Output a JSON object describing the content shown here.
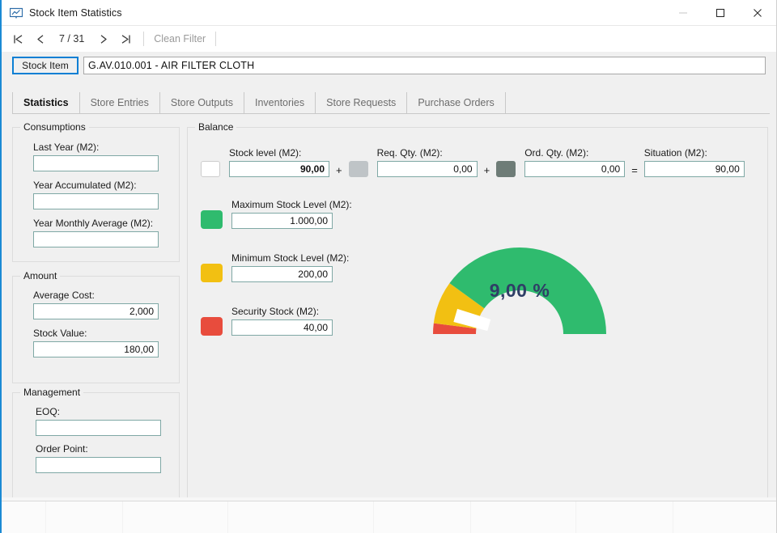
{
  "window": {
    "title": "Stock Item Statistics",
    "icon": "chart-window-icon",
    "minimize_label": "—",
    "maximize_label": "□",
    "close_label": "✕"
  },
  "toolbar": {
    "first_icon": "first-record-icon",
    "prev_icon": "previous-record-icon",
    "counter": "7 / 31",
    "next_icon": "next-record-icon",
    "last_icon": "last-record-icon",
    "clean_filter_label": "Clean Filter"
  },
  "item_row": {
    "button_label": "Stock Item",
    "value": "G.AV.010.001 - AIR FILTER CLOTH",
    "placeholder": ""
  },
  "tabs": [
    {
      "label": "Statistics",
      "active": true
    },
    {
      "label": "Store Entries",
      "active": false
    },
    {
      "label": "Store Outputs",
      "active": false
    },
    {
      "label": "Inventories",
      "active": false
    },
    {
      "label": "Store Requests",
      "active": false
    },
    {
      "label": "Purchase Orders",
      "active": false
    }
  ],
  "consumptions": {
    "title": "Consumptions",
    "fields": [
      {
        "label": "Last Year (M2):",
        "value": ""
      },
      {
        "label": "Year Accumulated (M2):",
        "value": ""
      },
      {
        "label": "Year Monthly Average (M2):",
        "value": ""
      }
    ]
  },
  "amount": {
    "title": "Amount",
    "fields": [
      {
        "label": "Average Cost:",
        "value": "2,000"
      },
      {
        "label": "Stock Value:",
        "value": "180,00"
      }
    ]
  },
  "management": {
    "title": "Management",
    "fields": [
      {
        "label": "EOQ:",
        "value": ""
      },
      {
        "label": "Order Point:",
        "value": ""
      }
    ]
  },
  "balance": {
    "title": "Balance",
    "formula": [
      {
        "label": "Stock level (M2):",
        "value": "90,00",
        "swatch": "#ffffff",
        "bold": true,
        "operator_after": "+"
      },
      {
        "label": "Req. Qty. (M2):",
        "value": "0,00",
        "swatch": "#bfc4c7",
        "bold": false,
        "operator_after": "+"
      },
      {
        "label": "Ord. Qty. (M2):",
        "value": "0,00",
        "swatch": "#6e7c77",
        "bold": false,
        "operator_after": "="
      },
      {
        "label": "Situation (M2):",
        "value": "90,00",
        "swatch": "",
        "bold": false,
        "operator_after": ""
      }
    ],
    "levels": [
      {
        "label": "Maximum Stock Level (M2):",
        "value": "1.000,00",
        "swatch": "#2fbb6e"
      },
      {
        "label": "Minimum Stock  Level (M2):",
        "value": "200,00",
        "swatch": "#f2c012"
      },
      {
        "label": "Security Stock (M2):",
        "value": "40,00",
        "swatch": "#e84c3d"
      }
    ]
  },
  "chart_data": {
    "type": "pie",
    "subtype": "gauge",
    "title": "",
    "value": 9.0,
    "value_label": "9,00 %",
    "unit": "%",
    "range": [
      0,
      100
    ],
    "start_angle": 180,
    "end_angle": 360,
    "needle_value": 9.0,
    "needle_color": "#ffffff",
    "value_text_color": "#2f3e66",
    "bands": [
      {
        "name": "Security Stock",
        "from": 0,
        "to": 4,
        "color": "#e84c3d"
      },
      {
        "name": "Minimum Stock Level",
        "from": 4,
        "to": 20,
        "color": "#f2c012"
      },
      {
        "name": "Maximum Stock Level",
        "from": 20,
        "to": 100,
        "color": "#2fbb6e"
      }
    ],
    "legend_position": "left",
    "grid": false
  },
  "colors": {
    "accent": "#0a7fd4",
    "window_edge": "#1b8ad4",
    "input_border": "#7fa8a5",
    "green": "#2fbb6e",
    "yellow": "#f2c012",
    "red": "#e84c3d",
    "gray_light": "#bfc4c7",
    "gray_dark": "#6e7c77"
  }
}
